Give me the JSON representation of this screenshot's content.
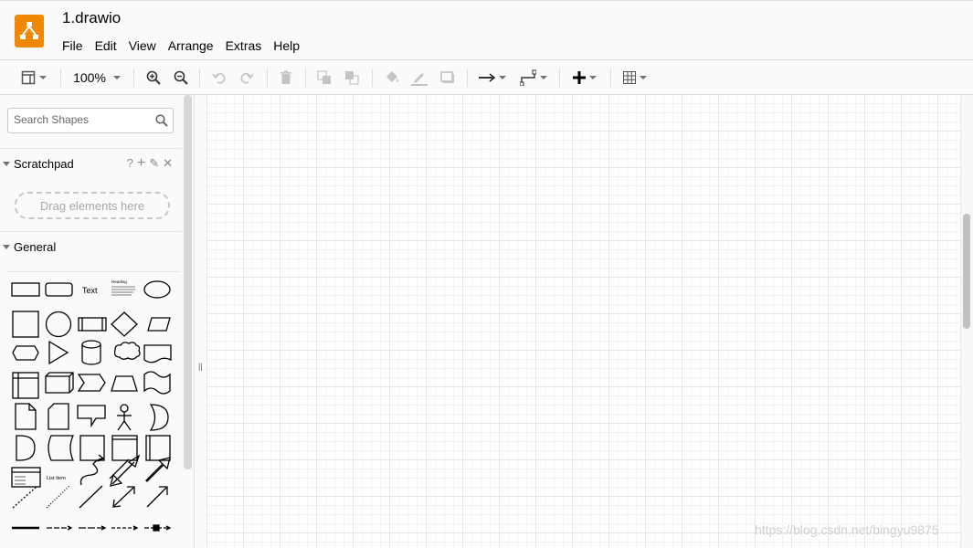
{
  "app": {
    "title": "1.drawio",
    "logo_color": "#f08705",
    "logo_icon": "drawio-logo-icon"
  },
  "menu": [
    "File",
    "Edit",
    "View",
    "Arrange",
    "Extras",
    "Help"
  ],
  "toolbar": {
    "zoom": "100%",
    "buttons": [
      "format-panel",
      "zoom",
      "zoom-in",
      "zoom-out",
      "undo",
      "redo",
      "delete",
      "to-front",
      "to-back",
      "fill-color",
      "line-color",
      "shadow",
      "connection",
      "waypoints",
      "insert",
      "table"
    ]
  },
  "sidebar": {
    "search_placeholder": "Search Shapes",
    "scratchpad": {
      "title": "Scratchpad",
      "help": "?",
      "add": "+",
      "edit": "✎",
      "close": "✕",
      "drop_hint": "Drag elements here"
    },
    "general": {
      "title": "General",
      "text_shape_label": "Text",
      "heading_shape_label": "Heading",
      "list_shape_label": "List Item"
    }
  },
  "watermark": "https://blog.csdn.net/bingyu9875"
}
